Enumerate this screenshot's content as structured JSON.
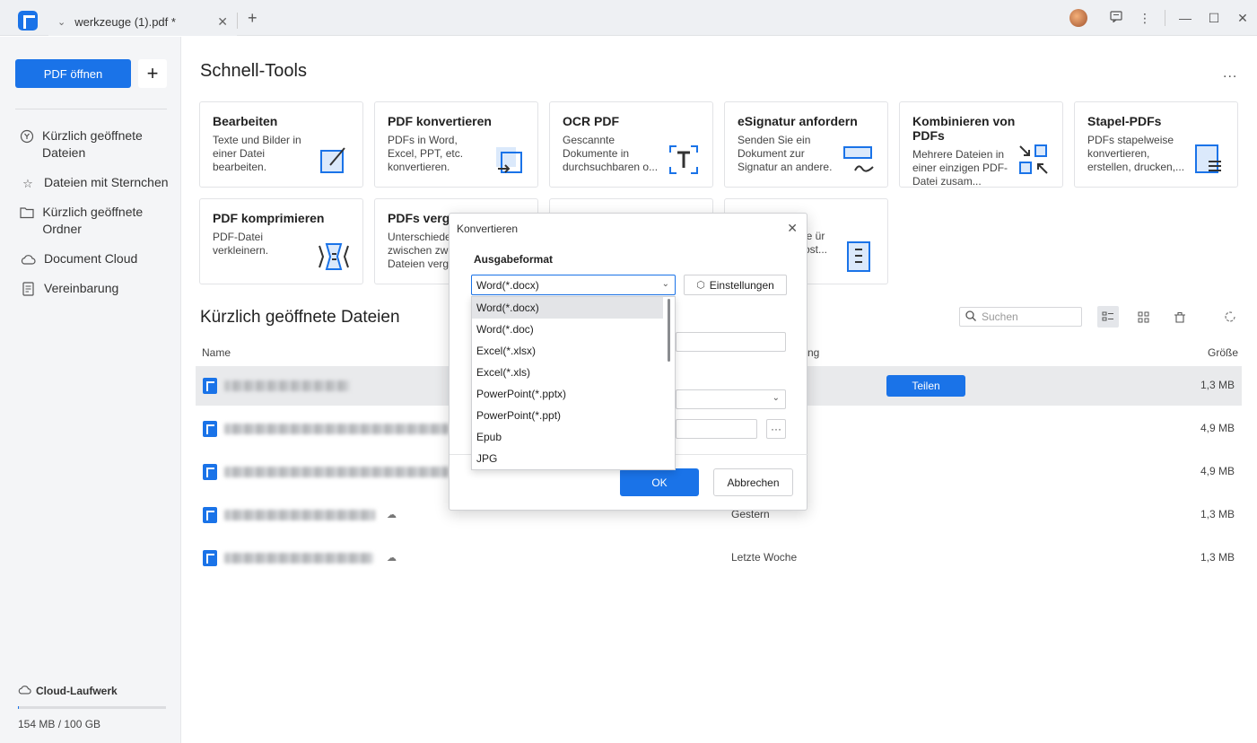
{
  "titlebar": {
    "tab_label": "werkzeuge (1).pdf *",
    "tab_close": "✕",
    "new_tab": "+"
  },
  "sidebar": {
    "open_label": "PDF öffnen",
    "plus_label": "+",
    "items": [
      {
        "label": "Kürzlich geöffnete Dateien",
        "icon": "recent-icon"
      },
      {
        "label": "Dateien mit Sternchen",
        "icon": "star-icon"
      },
      {
        "label": "Kürzlich geöffnete Ordner",
        "icon": "folder-icon"
      },
      {
        "label": "Document Cloud",
        "icon": "cloud-icon"
      },
      {
        "label": "Vereinbarung",
        "icon": "document-icon"
      }
    ],
    "cloud_drive": "Cloud-Laufwerk",
    "storage": "154 MB / 100 GB",
    "storage_fraction": 0.0015
  },
  "main": {
    "title": "Schnell-Tools",
    "more": "...",
    "tools": [
      {
        "title": "Bearbeiten",
        "desc": "Texte und Bilder in einer Datei bearbeiten.",
        "icon": "edit-icon"
      },
      {
        "title": "PDF konvertieren",
        "desc": "PDFs in Word, Excel, PPT, etc. konvertieren.",
        "icon": "convert-icon"
      },
      {
        "title": "OCR PDF",
        "desc": "Gescannte Dokumente in durchsuchbaren o...",
        "icon": "ocr-icon"
      },
      {
        "title": "eSignatur anfordern",
        "desc": "Senden Sie ein Dokument zur Signatur an andere.",
        "icon": "signature-icon"
      },
      {
        "title": "Kombinieren von PDFs",
        "desc": "Mehrere Dateien in einer einzigen PDF-Datei zusam...",
        "icon": "combine-icon"
      },
      {
        "title": "Stapel-PDFs",
        "desc": "PDFs stapelweise konvertieren, erstellen, drucken,...",
        "icon": "batch-icon"
      },
      {
        "title": "PDF komprimieren",
        "desc": "PDF-Datei verkleinern.",
        "icon": "compress-icon"
      },
      {
        "title": "PDFs vergl",
        "desc": "Unterschiede zwischen zwe Dateien vergl",
        "icon": "compare-icon"
      },
      {
        "title": "",
        "desc": "",
        "icon": ""
      },
      {
        "title": "",
        "desc": "le ür ost...",
        "icon": "template-icon"
      }
    ],
    "recent_title": "Kürzlich geöffnete Dateien",
    "search_placeholder": "Suchen",
    "columns": {
      "name": "Name",
      "date": "ng",
      "size": "Größe"
    },
    "files": [
      {
        "date": "",
        "size": "1,3 MB",
        "share": "Teilen",
        "cloud": false
      },
      {
        "date": "",
        "size": "4,9 MB",
        "cloud": false
      },
      {
        "date": "",
        "size": "4,9 MB",
        "cloud": false
      },
      {
        "date": "Gestern",
        "size": "1,3 MB",
        "cloud": true
      },
      {
        "date": "Letzte Woche",
        "size": "1,3 MB",
        "cloud": true
      }
    ]
  },
  "dialog": {
    "title": "Konvertieren",
    "close": "✕",
    "format_label": "Ausgabeformat",
    "selected_format": "Word(*.docx)",
    "settings_label": "Einstellungen",
    "ok_label": "OK",
    "cancel_label": "Abbrechen",
    "dots": "···",
    "options": [
      "Word(*.docx)",
      "Word(*.doc)",
      "Excel(*.xlsx)",
      "Excel(*.xls)",
      "PowerPoint(*.pptx)",
      "PowerPoint(*.ppt)",
      "Epub",
      "JPG"
    ]
  },
  "colors": {
    "accent": "#1a73e8"
  }
}
